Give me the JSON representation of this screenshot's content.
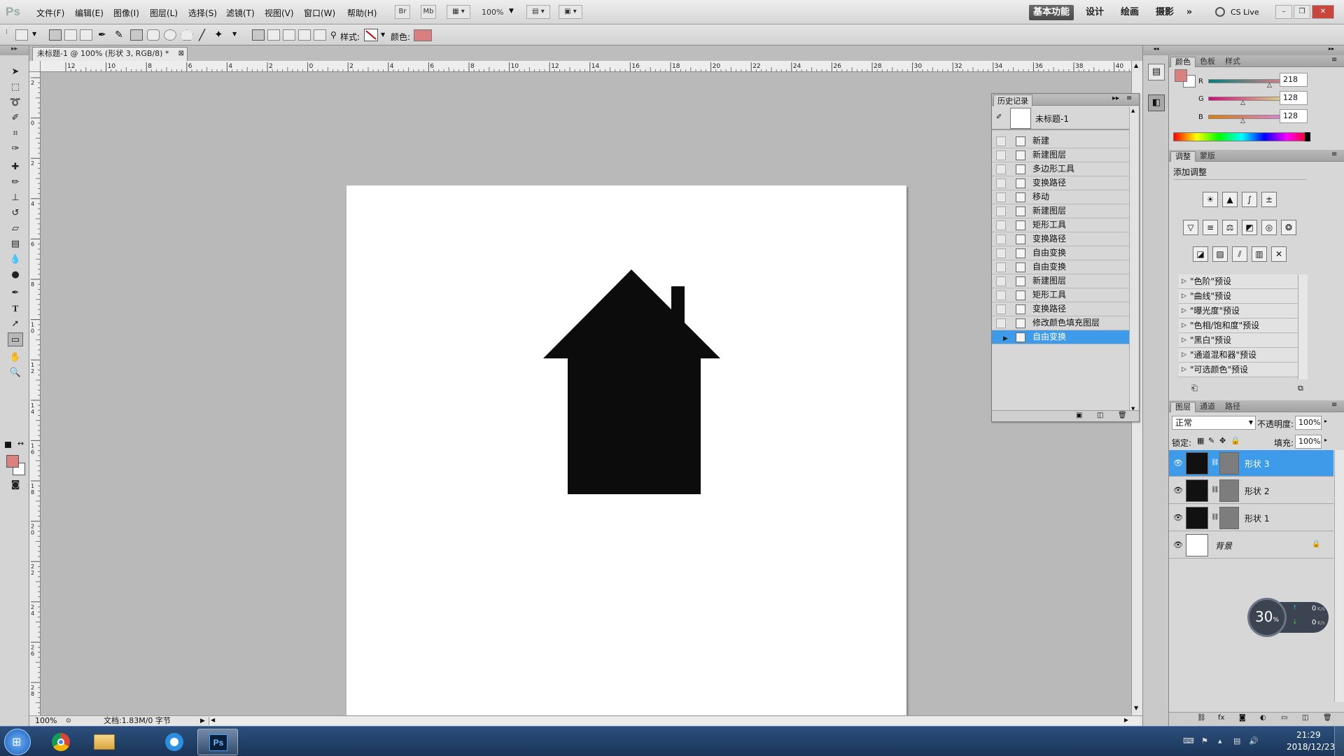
{
  "app": {
    "logo": "Ps"
  },
  "menu": [
    "文件(F)",
    "编辑(E)",
    "图像(I)",
    "图层(L)",
    "选择(S)",
    "滤镜(T)",
    "视图(V)",
    "窗口(W)",
    "帮助(H)"
  ],
  "appbar": {
    "bridge": "Br",
    "minibridge": "Mb",
    "zoom": "100%"
  },
  "workspaces": [
    "基本功能",
    "设计",
    "绘画",
    "摄影"
  ],
  "workspaces_more": "»",
  "cslive": "CS Live",
  "options": {
    "style_label": "样式:",
    "color_label": "颜色:",
    "color_swatch": "#d87f80"
  },
  "document": {
    "tab_title": "未标题-1 @ 100% (形状 3, RGB/8) *",
    "hruler_ticks": [
      "12",
      "10",
      "8",
      "6",
      "4",
      "2",
      "0",
      "2",
      "4",
      "6",
      "8",
      "10",
      "12",
      "14",
      "16",
      "18",
      "20",
      "22",
      "24",
      "26",
      "28",
      "30",
      "32",
      "34",
      "36",
      "38",
      "40"
    ],
    "vruler_ticks": [
      "2",
      "0",
      "2",
      "4",
      "6",
      "8",
      "10",
      "12",
      "14",
      "16",
      "18",
      "20",
      "22",
      "24",
      "26",
      "28"
    ],
    "zoom": "100%",
    "status": "文档:1.83M/0 字节"
  },
  "history": {
    "title": "历史记录",
    "snapshot": "未标题-1",
    "items": [
      "新建",
      "新建图层",
      "多边形工具",
      "变换路径",
      "移动",
      "新建图层",
      "矩形工具",
      "变换路径",
      "自由变换",
      "自由变换",
      "新建图层",
      "矩形工具",
      "变换路径",
      "修改颜色填充图层",
      "自由变换"
    ]
  },
  "color_panel": {
    "tabs": [
      "颜色",
      "色板",
      "样式"
    ],
    "r_label": "R",
    "g_label": "G",
    "b_label": "B",
    "r": "218",
    "g": "128",
    "b": "128",
    "fg": "#da8080",
    "bg": "#ffffff"
  },
  "adjust_panel": {
    "tabs": [
      "调整",
      "蒙版"
    ],
    "title": "添加调整",
    "presets": [
      "\"色阶\"预设",
      "\"曲线\"预设",
      "\"曝光度\"预设",
      "\"色相/饱和度\"预设",
      "\"黑白\"预设",
      "\"通道混和器\"预设",
      "\"可选颜色\"预设"
    ]
  },
  "layers_panel": {
    "tabs": [
      "图层",
      "通道",
      "路径"
    ],
    "blend_mode": "正常",
    "opacity_label": "不透明度:",
    "opacity": "100%",
    "lock_label": "锁定:",
    "fill_label": "填充:",
    "fill": "100%",
    "layers": [
      "形状 3",
      "形状 2",
      "形状 1",
      "背景"
    ]
  },
  "net_widget": {
    "percent": "30",
    "unit": "%",
    "up": "0",
    "down": "0",
    "speed_unit": "K/s"
  },
  "taskbar": {
    "time": "21:29",
    "date": "2018/12/23",
    "ps_label": "Ps"
  }
}
